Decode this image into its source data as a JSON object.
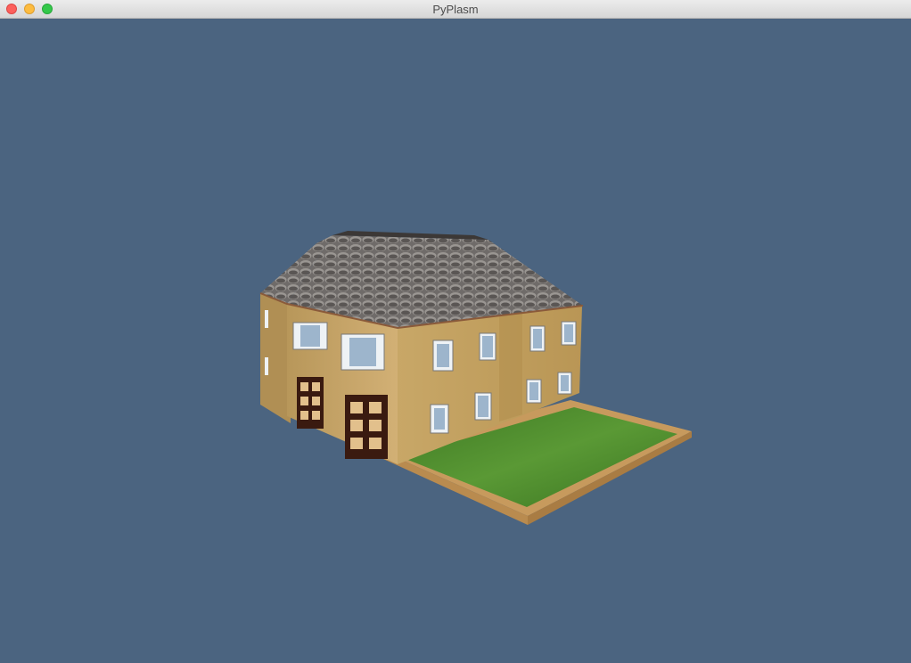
{
  "window": {
    "title": "PyPlasm"
  },
  "scene": {
    "background_color": "#4b6480",
    "model": "house",
    "roof_color": "#7b7775",
    "wall_color": "#c9a566",
    "lawn_color": "#4f8a2c",
    "border_color": "#d9b27a",
    "door_color": "#3a1a10"
  }
}
